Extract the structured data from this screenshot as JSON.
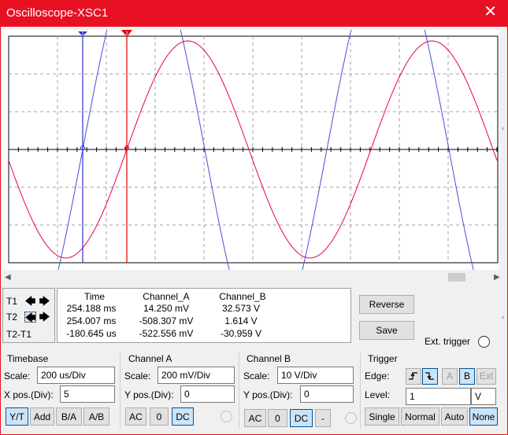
{
  "window": {
    "title": "Oscilloscope-XSC1",
    "close_glyph": "✕"
  },
  "cursors": {
    "t1_label": "T1",
    "t2_label": "T2",
    "t2t1_label": "T2-T1",
    "t2_selected": true,
    "t1_marker": "1",
    "t2_marker": "2"
  },
  "readout": {
    "headers": {
      "time": "Time",
      "channel_a": "Channel_A",
      "channel_b": "Channel_B"
    },
    "rows": [
      {
        "time": "254.188 ms",
        "channel_a": "14.250 mV",
        "channel_b": "32.573 V"
      },
      {
        "time": "254.007 ms",
        "channel_a": "-508.307 mV",
        "channel_b": "1.614 V"
      },
      {
        "time": "-180.645 us",
        "channel_a": "-522.556 mV",
        "channel_b": "-30.959 V"
      }
    ]
  },
  "actions": {
    "reverse": "Reverse",
    "save": "Save",
    "ext_trigger": "Ext. trigger"
  },
  "timebase": {
    "title": "Timebase",
    "scale_label": "Scale:",
    "scale_value": "200 us/Div",
    "xpos_label": "X pos.(Div):",
    "xpos_value": "5",
    "modes": [
      "Y/T",
      "Add",
      "B/A",
      "A/B"
    ],
    "active_mode": "Y/T"
  },
  "channel_a": {
    "title": "Channel A",
    "scale_label": "Scale:",
    "scale_value": "200 mV/Div",
    "ypos_label": "Y pos.(Div):",
    "ypos_value": "0",
    "coupling": [
      "AC",
      "0",
      "DC"
    ],
    "active_coupling": "DC"
  },
  "channel_b": {
    "title": "Channel B",
    "scale_label": "Scale:",
    "scale_value": "10  V/Div",
    "ypos_label": "Y pos.(Div):",
    "ypos_value": "0",
    "coupling": [
      "AC",
      "0",
      "DC",
      "-"
    ],
    "active_coupling": "DC"
  },
  "trigger": {
    "title": "Trigger",
    "edge_label": "Edge:",
    "sources": [
      "A",
      "B",
      "Ext"
    ],
    "active_source": "B",
    "level_label": "Level:",
    "level_value": "1",
    "level_unit": "V",
    "modes": [
      "Single",
      "Normal",
      "Auto",
      "None"
    ],
    "active_mode": "None"
  },
  "colors": {
    "channel_a": "#e8004a",
    "channel_b": "#4a4adf",
    "cursor1": "#3030d0",
    "cursor2": "#e00000",
    "titlebar": "#e81123"
  }
}
